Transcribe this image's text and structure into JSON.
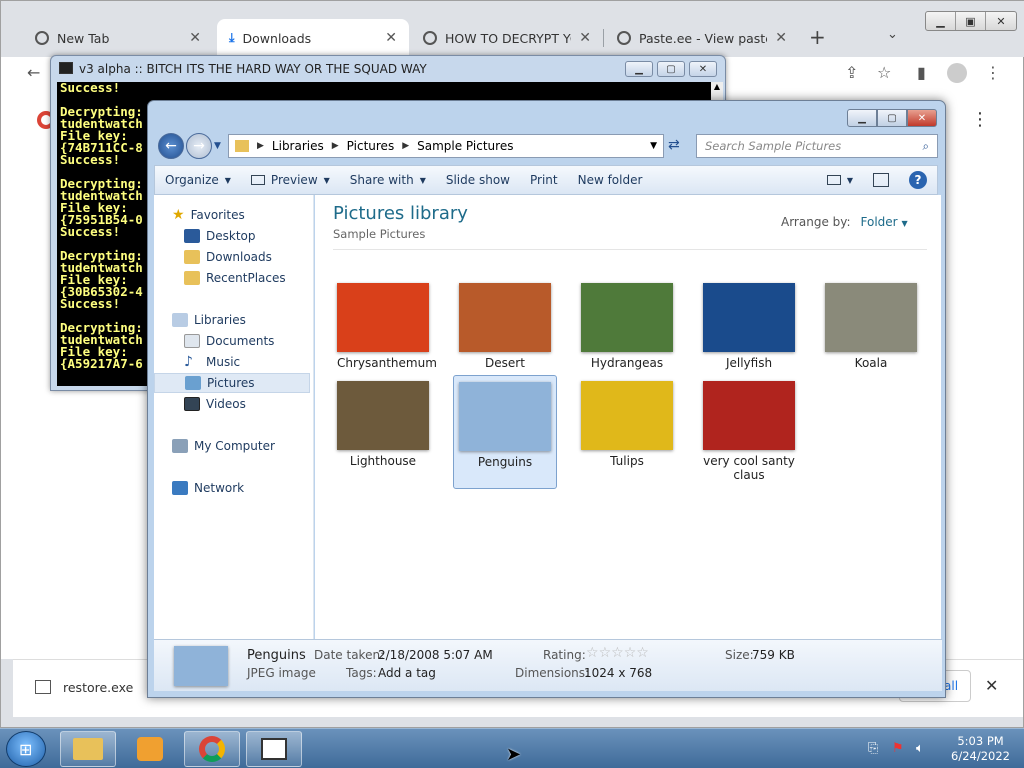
{
  "browser": {
    "tabs": [
      {
        "label": "New Tab"
      },
      {
        "label": "Downloads"
      },
      {
        "label": "HOW TO DECRYPT YOUR"
      },
      {
        "label": "Paste.ee - View paste uSyc"
      }
    ],
    "new_tab": "+",
    "download_bar": {
      "filename": "restore.exe",
      "show_all": "all",
      "close": "✕"
    }
  },
  "console": {
    "title": "v3 alpha :: BITCH ITS THE HARD WAY OR THE SQUAD WAY",
    "lines": [
      "Success!",
      "",
      "Decrypting:",
      "tudentwatch",
      "File key:",
      "{74B711CC-8",
      "Success!",
      "",
      "Decrypting:",
      "tudentwatch",
      "File key:",
      "{75951B54-0",
      "Success!",
      "",
      "Decrypting:",
      "tudentwatch",
      "File key:",
      "{30B65302-4",
      "Success!",
      "",
      "Decrypting:",
      "tudentwatch",
      "File key:",
      "{A59217A7-6"
    ]
  },
  "explorer": {
    "breadcrumb": [
      "Libraries",
      "Pictures",
      "Sample Pictures"
    ],
    "search_placeholder": "Search Sample Pictures",
    "commands": [
      "Organize",
      "Preview",
      "Share with",
      "Slide show",
      "Print",
      "New folder"
    ],
    "nav": {
      "favorites": "Favorites",
      "fav_items": [
        "Desktop",
        "Downloads",
        "RecentPlaces"
      ],
      "libraries": "Libraries",
      "lib_items": [
        "Documents",
        "Music",
        "Pictures",
        "Videos"
      ],
      "computer": "My Computer",
      "network": "Network"
    },
    "library_title": "Pictures library",
    "library_sub": "Sample Pictures",
    "arrange_label": "Arrange by:",
    "arrange_value": "Folder",
    "files": [
      {
        "name": "Chrysanthemum",
        "color": "#d9401a"
      },
      {
        "name": "Desert",
        "color": "#b85a2a"
      },
      {
        "name": "Hydrangeas",
        "color": "#4f7a3a"
      },
      {
        "name": "Jellyfish",
        "color": "#1a4b8c"
      },
      {
        "name": "Koala",
        "color": "#8a8a7a"
      },
      {
        "name": "Lighthouse",
        "color": "#6d5a3c"
      },
      {
        "name": "Penguins",
        "color": "#8fb3d9"
      },
      {
        "name": "Tulips",
        "color": "#e0b81a"
      },
      {
        "name": "very cool santy claus",
        "color": "#b0241e"
      }
    ],
    "details": {
      "name": "Penguins",
      "type": "JPEG image",
      "date_label": "Date taken:",
      "date_value": "2/18/2008 5:07 AM",
      "tags_label": "Tags:",
      "tags_value": "Add a tag",
      "rating_label": "Rating:",
      "dimensions_label": "Dimensions:",
      "dimensions_value": "1024 x 768",
      "size_label": "Size:",
      "size_value": "759 KB"
    }
  },
  "taskbar": {
    "time": "5:03 PM",
    "date": "6/24/2022"
  }
}
